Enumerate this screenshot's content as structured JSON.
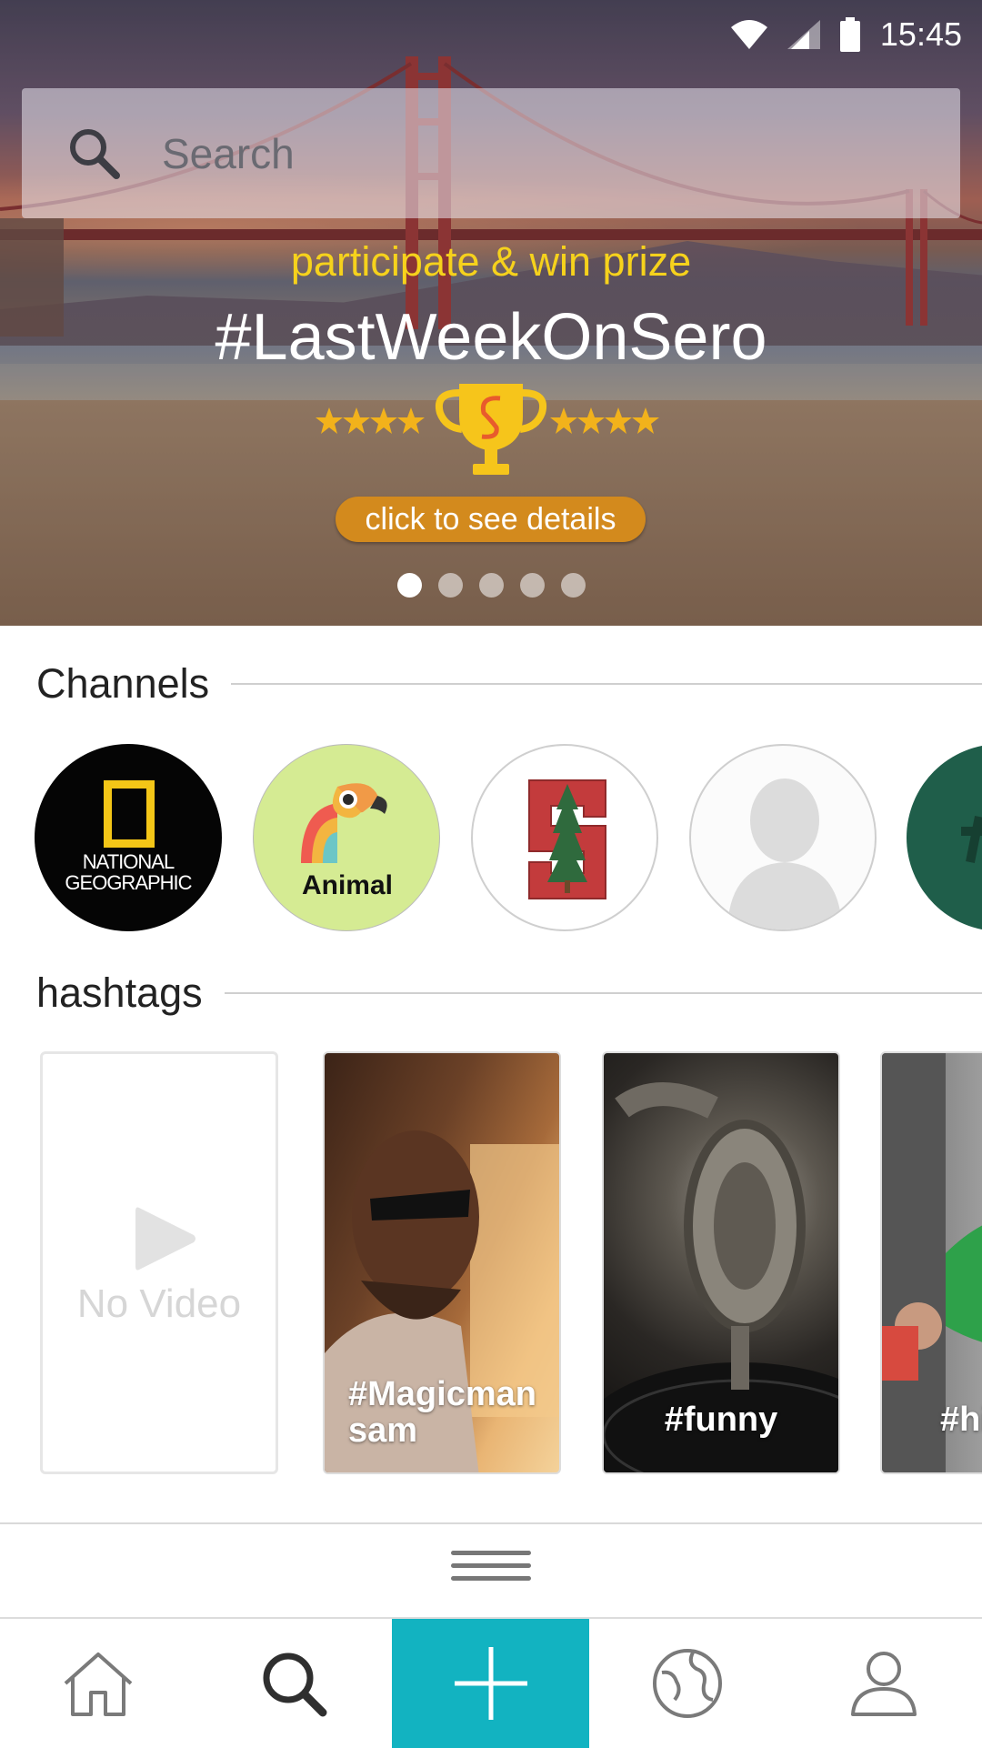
{
  "status_bar": {
    "time": "15:45"
  },
  "search": {
    "placeholder": "Search"
  },
  "promo": {
    "subtitle": "participate & win prize",
    "title": "#LastWeekOnSero",
    "button_label": "click to see details",
    "carousel": {
      "total": 5,
      "active": 1
    }
  },
  "channels": {
    "title": "Channels",
    "items": [
      {
        "name": "NATIONAL GEOGRAPHIC",
        "line1": "NATIONAL",
        "line2": "GEOGRAPHIC"
      },
      {
        "name": "Animal"
      },
      {
        "name": "stanford-logo"
      },
      {
        "name": "default-avatar"
      },
      {
        "name": "green-channel"
      }
    ]
  },
  "hashtags": {
    "title": "hashtags",
    "empty_label": "No Video",
    "items": [
      {
        "line1": "#Magicman",
        "line2": "sam"
      },
      {
        "line1": "#funny"
      },
      {
        "line1": "#hi"
      }
    ]
  },
  "nav": {
    "icons": [
      "home-icon",
      "search-icon",
      "add-icon",
      "explore-icon",
      "profile-icon"
    ],
    "accent_color": "#12b3c1"
  },
  "colors": {
    "promo_yellow": "#f6d21c",
    "button_orange": "#d38a1d"
  }
}
